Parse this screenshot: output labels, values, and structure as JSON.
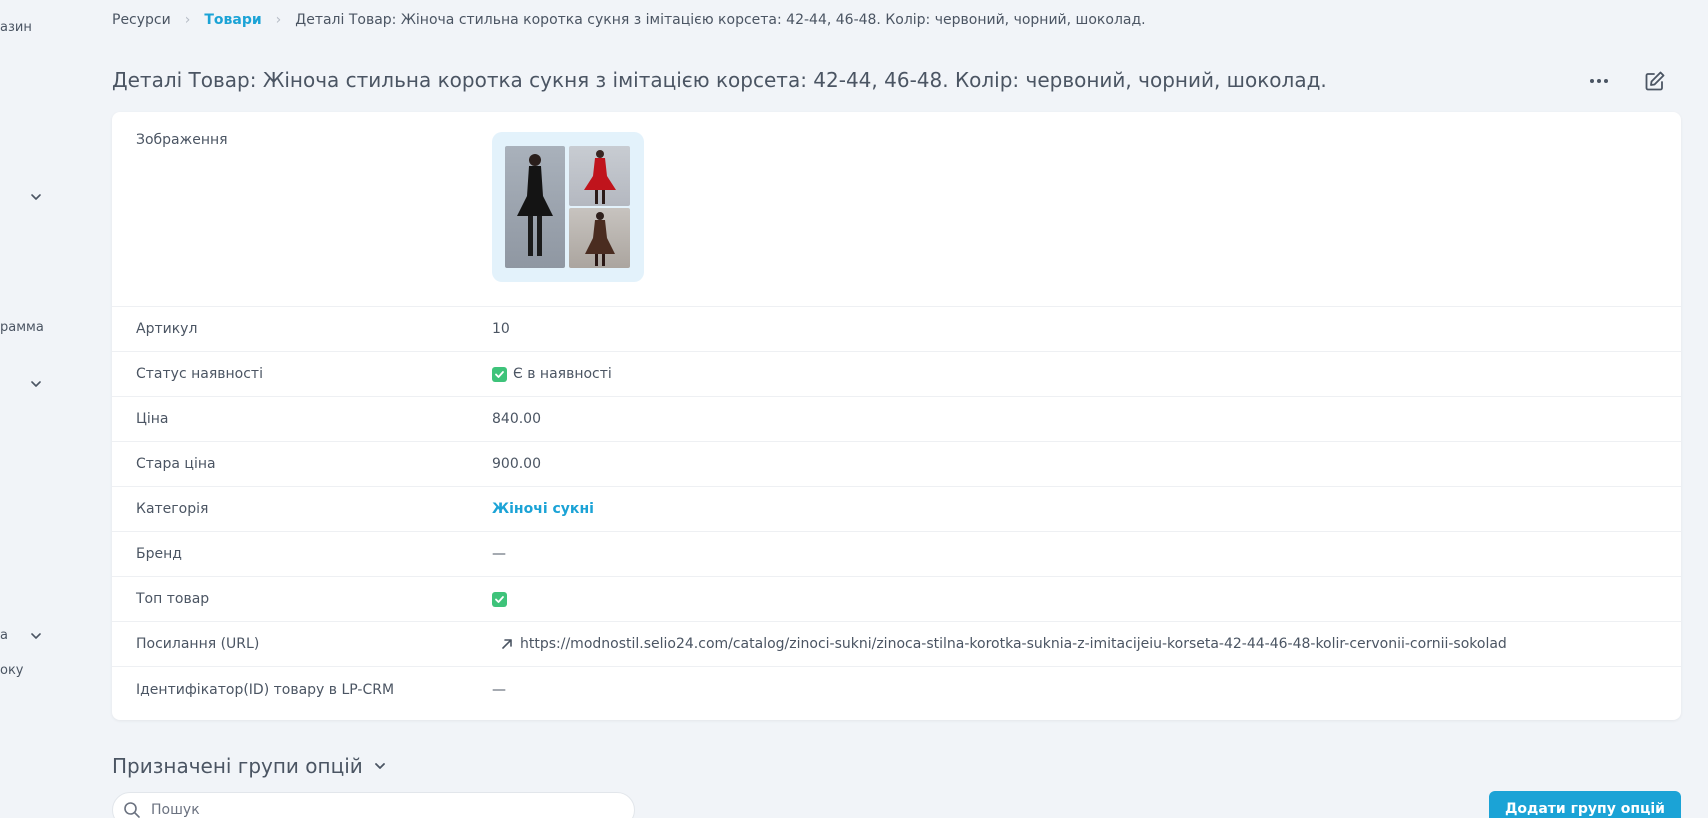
{
  "sidebar_fragments": [
    "азин",
    "рамма",
    "а",
    "оку"
  ],
  "breadcrumb": {
    "items": [
      "Ресурси",
      "Товари",
      "Деталі Товар: Жіноча стильна коротка сукня з імітацією корсета: 42-44, 46-48. Колір: червоний, чорний, шоколад."
    ]
  },
  "page": {
    "title": "Деталі Товар: Жіноча стильна коротка сукня з імітацією корсета: 42-44, 46-48. Колір: червоний, чорний, шоколад."
  },
  "details": {
    "image_label": "Зображення",
    "sku": {
      "label": "Артикул",
      "value": "10"
    },
    "availability": {
      "label": "Статус наявності",
      "value": "Є в наявності"
    },
    "price": {
      "label": "Ціна",
      "value": "840.00"
    },
    "old_price": {
      "label": "Стара ціна",
      "value": "900.00"
    },
    "category": {
      "label": "Категорія",
      "value": "Жіночі сукні"
    },
    "brand": {
      "label": "Бренд",
      "value": "—"
    },
    "top_product": {
      "label": "Топ товар",
      "checked": true
    },
    "url": {
      "label": "Посилання (URL)",
      "value": "https://modnostil.selio24.com/catalog/zinoci-sukni/zinoca-stilna-korotka-suknia-z-imitacijeiu-korseta-42-44-46-48-kolir-cervonii-cornii-sokolad"
    },
    "lp_crm_id": {
      "label": "Ідентифікатор(ID) товару в LP-CRM",
      "value": "—"
    }
  },
  "option_groups": {
    "title": "Призначені групи опцій",
    "search_placeholder": "Пошук",
    "add_button": "Додати групу опцій"
  },
  "colors": {
    "accent": "#1ba3d6",
    "check": "#3ec37a",
    "background": "#f1f4f8"
  }
}
